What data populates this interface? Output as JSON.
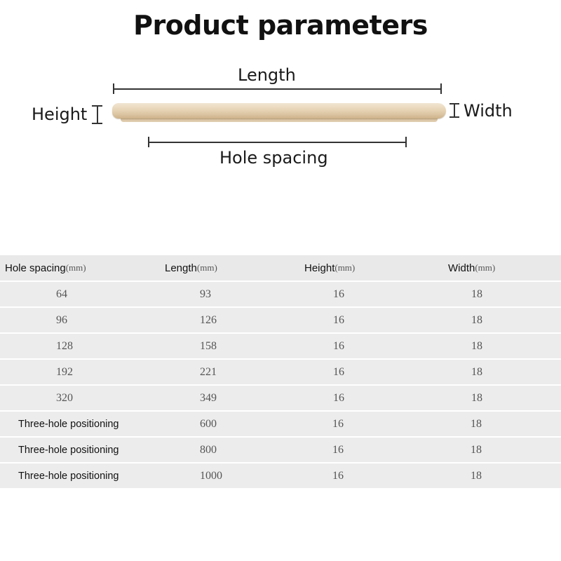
{
  "page_title": "Product parameters",
  "diagram": {
    "length_label": "Length",
    "height_label": "Height",
    "width_label": "Width",
    "hole_spacing_label": "Hole spacing"
  },
  "table": {
    "headers": [
      {
        "label": "Hole spacing",
        "unit": "(mm)"
      },
      {
        "label": "Length ",
        "unit": "(mm)"
      },
      {
        "label": "Height ",
        "unit": "(mm)"
      },
      {
        "label": "Width",
        "unit": "(mm)"
      }
    ],
    "rows": [
      [
        "64",
        "93",
        "16",
        "18"
      ],
      [
        "96",
        "126",
        "16",
        "18"
      ],
      [
        "128",
        "158",
        "16",
        "18"
      ],
      [
        "192",
        "221",
        "16",
        "18"
      ],
      [
        "320",
        "349",
        "16",
        "18"
      ],
      [
        "Three-hole positioning",
        "600",
        "16",
        "18"
      ],
      [
        "Three-hole positioning",
        "800",
        "16",
        "18"
      ],
      [
        "Three-hole positioning",
        "1000",
        "16",
        "18"
      ]
    ]
  }
}
